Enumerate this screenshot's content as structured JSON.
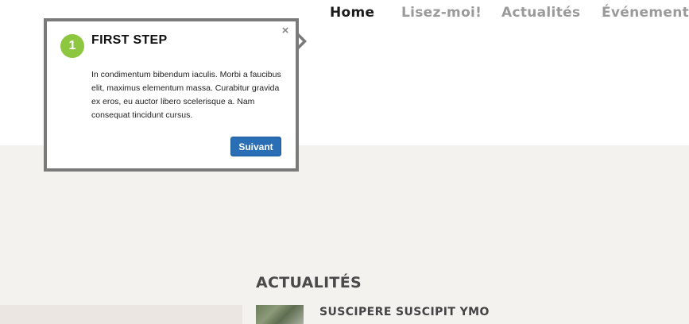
{
  "nav": {
    "items": [
      {
        "label": "Home",
        "active": true
      },
      {
        "label": "Lisez-moi!",
        "active": false
      },
      {
        "label": "Actualités",
        "active": false
      },
      {
        "label": "Événements",
        "active": false
      }
    ]
  },
  "tour": {
    "step_number": "1",
    "title": "FIRST STEP",
    "close_glyph": "×",
    "body": "In condimentum bibendum iaculis. Morbi a faucibus elit, maximus elementum massa. Curabitur gravida ex eros, eu auctor libero scelerisque a. Nam consequat tincidunt cursus.",
    "next_label": "Suivant",
    "badge_color": "#8dc63f",
    "button_color": "#2a6eb5"
  },
  "news": {
    "heading": "ACTUALITÉS",
    "items": [
      {
        "title": "SUSCIPERE SUSCIPIT YMO"
      }
    ]
  }
}
